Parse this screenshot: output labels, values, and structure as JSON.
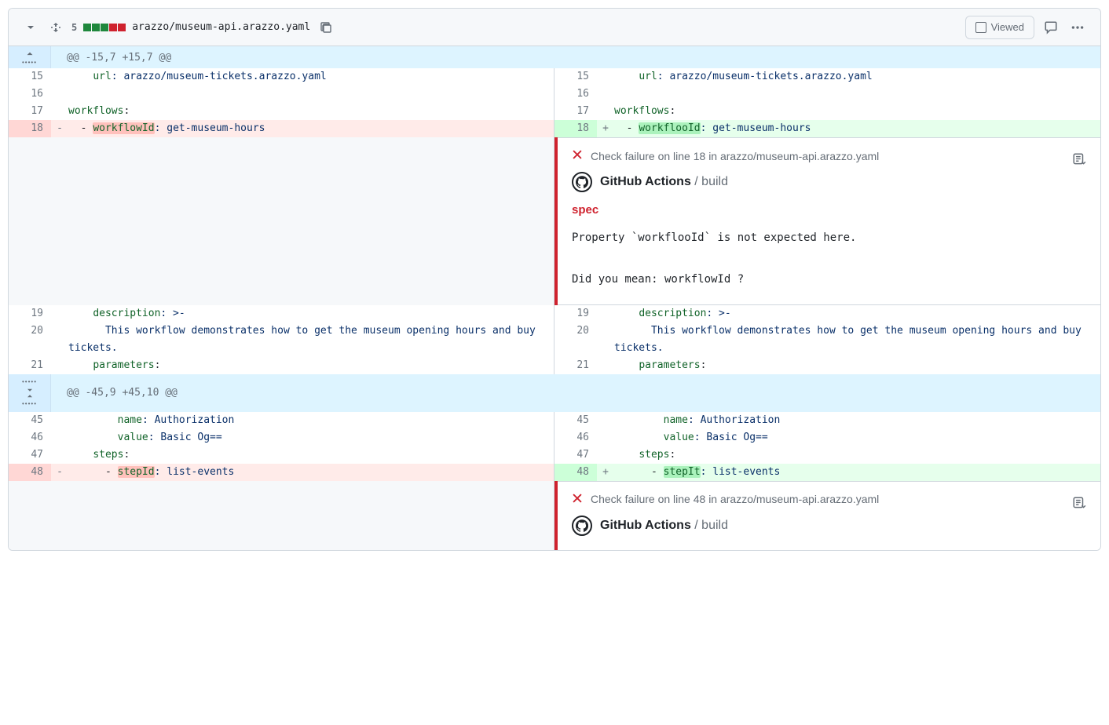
{
  "header": {
    "changes_count": "5",
    "file_path": "arazzo/museum-api.arazzo.yaml",
    "viewed_label": "Viewed"
  },
  "hunks": {
    "h1": "@@ -15,7 +15,7 @@",
    "h2": "@@ -45,9 +45,10 @@"
  },
  "left": {
    "l15_num": "15",
    "l15_key": "url",
    "l15_val": ": arazzo/museum-tickets.arazzo.yaml",
    "l16_num": "16",
    "l17_num": "17",
    "l17_key": "workflows",
    "l17_pun": ":",
    "l18_num": "18",
    "l18_prefix": "  - ",
    "l18_hl": "workflowId",
    "l18_after": ": get-museum-hours",
    "l19_num": "19",
    "l19_key": "description",
    "l19_val": ": >-",
    "l20_num": "20",
    "l20_text": "      This workflow demonstrates how to get the museum opening hours and buy tickets.",
    "l21_num": "21",
    "l21_key": "parameters",
    "l21_pun": ":",
    "l45_num": "45",
    "l45_key": "name",
    "l45_val": ": Authorization",
    "l46_num": "46",
    "l46_key": "value",
    "l46_val": ": Basic Og==",
    "l47_num": "47",
    "l47_key": "steps",
    "l47_pun": ":",
    "l48_num": "48",
    "l48_prefix": "      - ",
    "l48_hl": "stepId",
    "l48_after": ": list-events"
  },
  "right": {
    "r15_num": "15",
    "r15_key": "url",
    "r15_val": ": arazzo/museum-tickets.arazzo.yaml",
    "r16_num": "16",
    "r17_num": "17",
    "r17_key": "workflows",
    "r17_pun": ":",
    "r18_num": "18",
    "r18_prefix": "  - ",
    "r18_hl": "workflooId",
    "r18_after": ": get-museum-hours",
    "r19_num": "19",
    "r19_key": "description",
    "r19_val": ": >-",
    "r20_num": "20",
    "r20_text": "      This workflow demonstrates how to get the museum opening hours and buy tickets.",
    "r21_num": "21",
    "r21_key": "parameters",
    "r21_pun": ":",
    "r45_num": "45",
    "r45_key": "name",
    "r45_val": ": Authorization",
    "r46_num": "46",
    "r46_key": "value",
    "r46_val": ": Basic Og==",
    "r47_num": "47",
    "r47_key": "steps",
    "r47_pun": ":",
    "r48_num": "48",
    "r48_prefix": "      - ",
    "r48_hl": "stepIt",
    "r48_after": ": list-events"
  },
  "annotation1": {
    "header": "Check failure on line 18 in arazzo/museum-api.arazzo.yaml",
    "source_bold": "GitHub Actions",
    "source_rest": " / build",
    "spec_label": "spec",
    "msg1": "Property `workflooId` is not expected here.",
    "msg2": "Did you mean: workflowId ?"
  },
  "annotation2": {
    "header": "Check failure on line 48 in arazzo/museum-api.arazzo.yaml",
    "source_bold": "GitHub Actions",
    "source_rest": " / build"
  }
}
